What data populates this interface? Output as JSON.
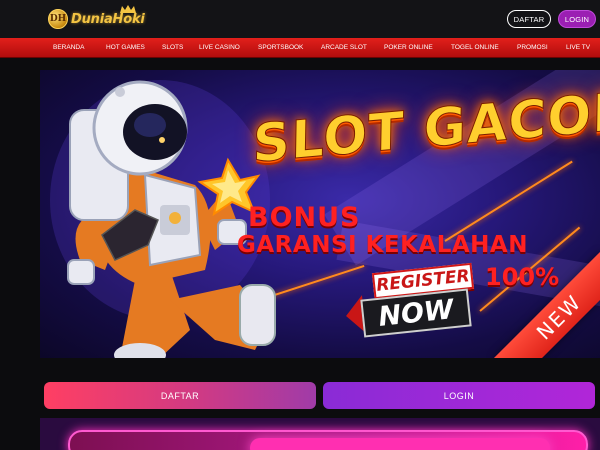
{
  "header": {
    "logo_text": "DuniaHoki",
    "logo_badge": "DH",
    "daftar_label": "DAFTAR",
    "login_label": "LOGIN"
  },
  "nav": {
    "items": [
      {
        "label": "BERANDA"
      },
      {
        "label": "HOT GAMES"
      },
      {
        "label": "SLOTS"
      },
      {
        "label": "LIVE CASINO"
      },
      {
        "label": "SPORTSBOOK"
      },
      {
        "label": "ARCADE SLOT"
      },
      {
        "label": "POKER ONLINE"
      },
      {
        "label": "TOGEL ONLINE"
      },
      {
        "label": "PROMOSI"
      },
      {
        "label": "LIVE TV"
      }
    ]
  },
  "banner": {
    "headline": "SLOT GACOR",
    "bonus": "BONUS",
    "garansi": "GARANSI KEKALAHAN",
    "percent": "100%",
    "register": "REGISTER",
    "now": "NOW",
    "ribbon": "NEW"
  },
  "actions": {
    "daftar_label": "DAFTAR",
    "login_label": "LOGIN"
  },
  "colors": {
    "nav_red": "#d3180f",
    "login_purple": "#9b1fb3",
    "gold": "#f3c443",
    "bonus_red": "#ff2121"
  }
}
